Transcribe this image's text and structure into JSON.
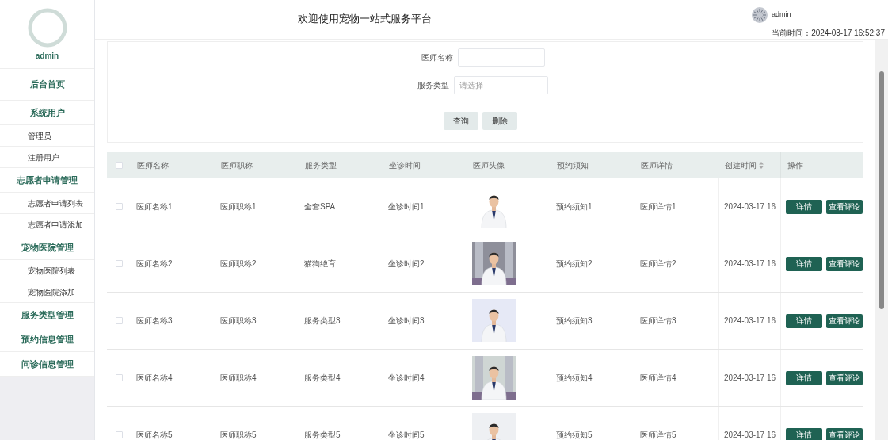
{
  "sidebar": {
    "user": "admin",
    "menu": [
      {
        "label": "后台首页",
        "kind": "group"
      },
      {
        "label": "系统用户",
        "kind": "group",
        "children": [
          {
            "label": "管理员",
            "kind": "item"
          },
          {
            "label": "注册用户",
            "kind": "item"
          }
        ]
      },
      {
        "label": "志愿者申请管理",
        "kind": "group",
        "children": [
          {
            "label": "志愿者申请列表",
            "kind": "item"
          },
          {
            "label": "志愿者申请添加",
            "kind": "item"
          }
        ]
      },
      {
        "label": "宠物医院管理",
        "kind": "group",
        "children": [
          {
            "label": "宠物医院列表",
            "kind": "item"
          },
          {
            "label": "宠物医院添加",
            "kind": "item"
          }
        ]
      },
      {
        "label": "服务类型管理",
        "kind": "group"
      },
      {
        "label": "预约信息管理",
        "kind": "group"
      },
      {
        "label": "问诊信息管理",
        "kind": "group"
      }
    ]
  },
  "header": {
    "title": "欢迎使用宠物一站式服务平台",
    "user": "admin",
    "time_label": "当前时间：",
    "time": "2024-03-17 16:52:37"
  },
  "search": {
    "fields": [
      {
        "label": "医师名称",
        "kind": "text"
      },
      {
        "label": "服务类型",
        "kind": "select",
        "placeholder": "请选择"
      }
    ],
    "buttons": [
      "查询",
      "删除"
    ]
  },
  "table": {
    "select_all": {
      "checked": false
    },
    "columns": [
      {
        "label": "医师名称"
      },
      {
        "label": "医师职称"
      },
      {
        "label": "服务类型"
      },
      {
        "label": "坐诊时间"
      },
      {
        "label": "医师头像"
      },
      {
        "label": "预约须知"
      },
      {
        "label": "医师详情"
      },
      {
        "label": "创建时间",
        "sortable": true
      },
      {
        "label": "操作"
      }
    ],
    "rows": [
      {
        "checked": false,
        "cells": [
          "医师名称1",
          "医师职称1",
          "全套SPA",
          "坐诊时间1",
          {
            "kind": "picture"
          },
          "预约须知1",
          "医师详情1",
          "2024-03-17 16",
          {
            "actions": [
              "详情",
              "查看评论"
            ]
          }
        ]
      },
      {
        "checked": false,
        "cells": [
          "医师名称2",
          "医师职称2",
          "猫狗绝育",
          "坐诊时间2",
          {
            "kind": "picture"
          },
          "预约须知2",
          "医师详情2",
          "2024-03-17 16",
          {
            "actions": [
              "详情",
              "查看评论"
            ]
          }
        ]
      },
      {
        "checked": false,
        "cells": [
          "医师名称3",
          "医师职称3",
          "服务类型3",
          "坐诊时间3",
          {
            "kind": "picture"
          },
          "预约须知3",
          "医师详情3",
          "2024-03-17 16",
          {
            "actions": [
              "详情",
              "查看评论"
            ]
          }
        ]
      },
      {
        "checked": false,
        "cells": [
          "医师名称4",
          "医师职称4",
          "服务类型4",
          "坐诊时间4",
          {
            "kind": "picture"
          },
          "预约须知4",
          "医师详情4",
          "2024-03-17 16",
          {
            "actions": [
              "详情",
              "查看评论"
            ]
          }
        ]
      },
      {
        "checked": false,
        "cells": [
          "医师名称5",
          "医师职称5",
          "服务类型5",
          "坐诊时间5",
          {
            "kind": "picture"
          },
          "预约须知5",
          "医师详情5",
          "2024-03-17 16",
          {
            "actions": [
              "详情",
              "查看评论"
            ]
          }
        ]
      }
    ]
  }
}
